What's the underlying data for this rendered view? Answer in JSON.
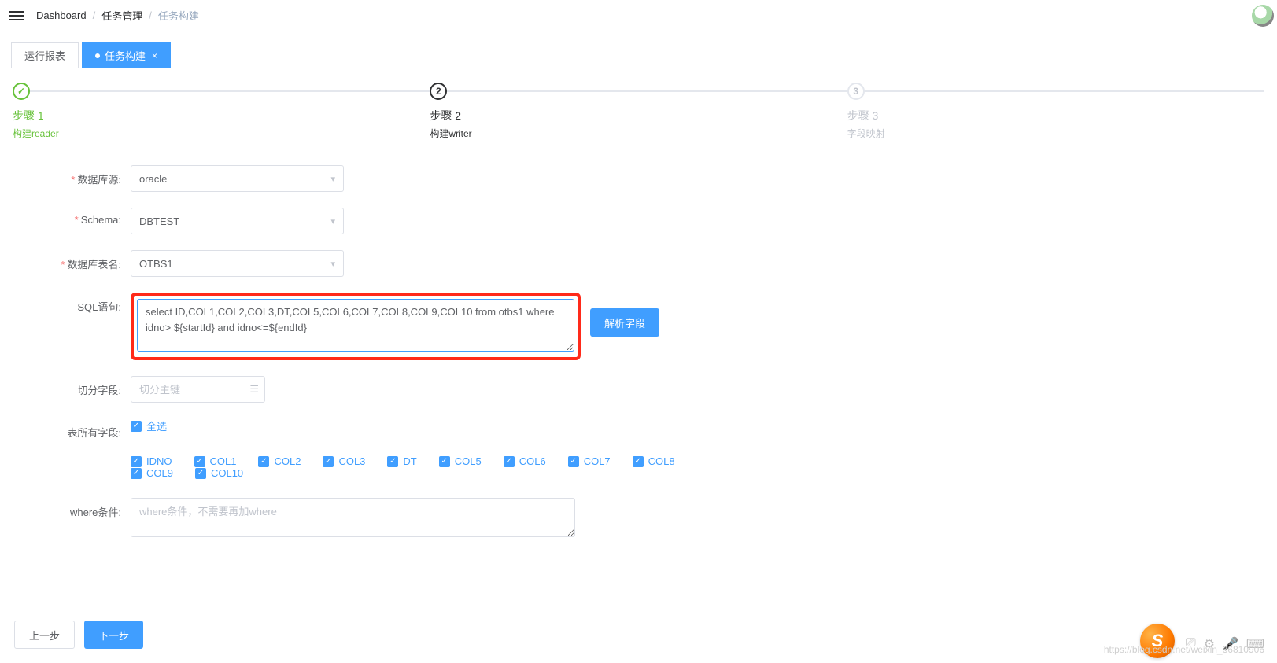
{
  "breadcrumb": {
    "items": [
      "Dashboard",
      "任务管理",
      "任务构建"
    ]
  },
  "tabs": {
    "report": "运行报表",
    "build": "任务构建"
  },
  "steps": [
    {
      "num": "✓",
      "title": "步骤 1",
      "sub": "构建reader",
      "state": "done"
    },
    {
      "num": "2",
      "title": "步骤 2",
      "sub": "构建writer",
      "state": "current"
    },
    {
      "num": "3",
      "title": "步骤 3",
      "sub": "字段映射",
      "state": "pending"
    }
  ],
  "form": {
    "datasource_label": "数据库源:",
    "datasource_value": "oracle",
    "schema_label": "Schema:",
    "schema_value": "DBTEST",
    "table_label": "数据库表名:",
    "table_value": "OTBS1",
    "sql_label": "SQL语句:",
    "sql_value": "select ID,COL1,COL2,COL3,DT,COL5,COL6,COL7,COL8,COL9,COL10 from otbs1 where idno> ${startId} and idno<=${endId}",
    "parse_btn": "解析字段",
    "split_label": "切分字段:",
    "split_placeholder": "切分主键",
    "allcols_label": "表所有字段:",
    "select_all": "全选",
    "columns": [
      "IDNO",
      "COL1",
      "COL2",
      "COL3",
      "DT",
      "COL5",
      "COL6",
      "COL7",
      "COL8",
      "COL9",
      "COL10"
    ],
    "where_label": "where条件:",
    "where_placeholder": "where条件，不需要再加where"
  },
  "footer": {
    "prev": "上一步",
    "next": "下一步"
  },
  "watermark": "https://blog.csdn.net/weixin_36810906",
  "ime_letter": "S"
}
